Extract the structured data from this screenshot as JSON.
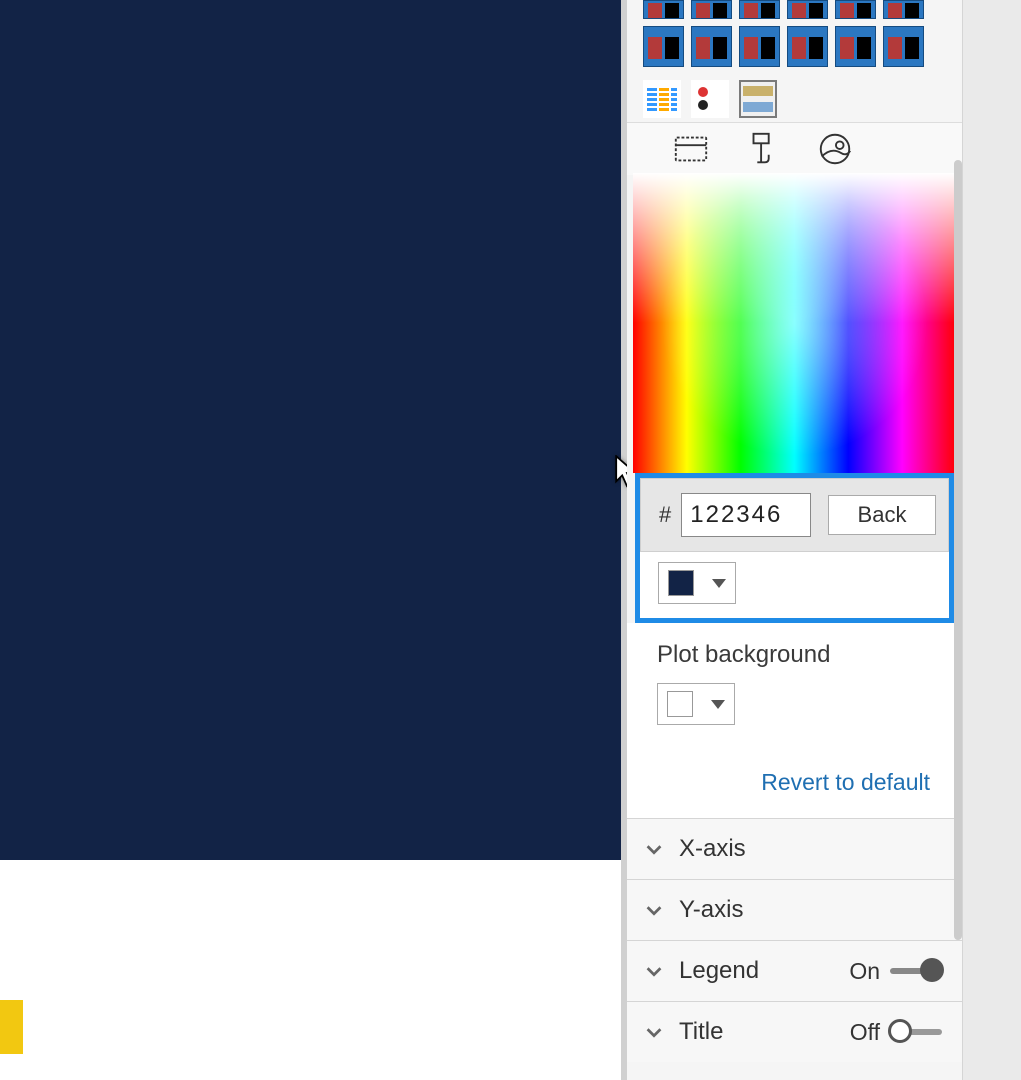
{
  "canvas": {
    "bg_color": "#122346"
  },
  "picker": {
    "hex_value": "122346",
    "back_label": "Back",
    "swatch_color": "#122346"
  },
  "plot_bg": {
    "label": "Plot background",
    "swatch_color": "#ffffff"
  },
  "revert_label": "Revert to default",
  "accordion": {
    "xaxis": {
      "label": "X-axis"
    },
    "yaxis": {
      "label": "Y-axis"
    },
    "legend": {
      "label": "Legend",
      "toggle_state": "On"
    },
    "title": {
      "label": "Title",
      "toggle_state": "Off"
    }
  }
}
